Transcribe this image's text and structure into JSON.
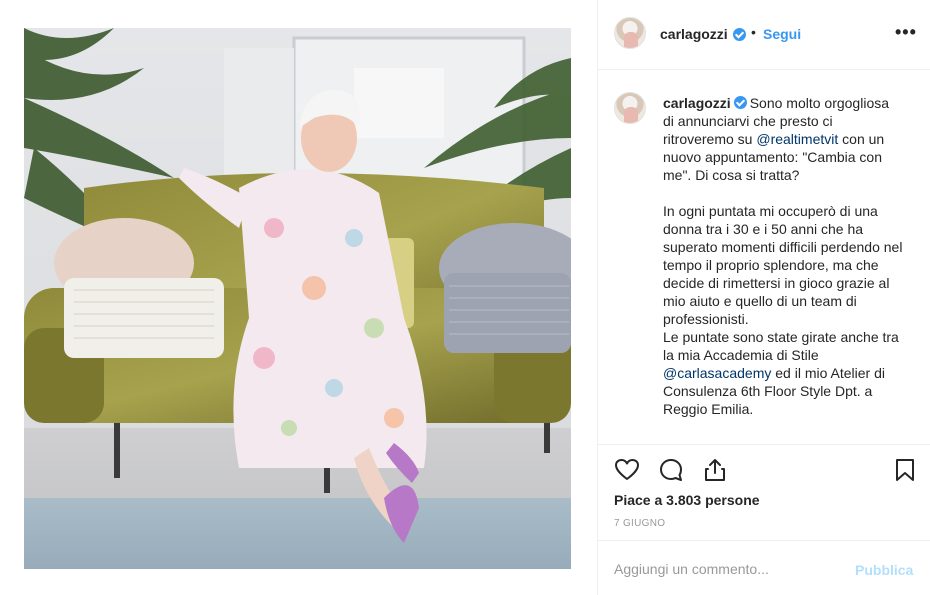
{
  "post": {
    "username": "carlagozzi",
    "separator": "•",
    "follow_label": "Segui",
    "more_label": "•••",
    "caption": {
      "username": "carlagozzi",
      "part1": "Sono molto orgogliosa di annunciarvi che presto ci ritroveremo su ",
      "mention1": "@realtimetvit",
      "part2": " con un nuovo appuntamento: \"Cambia con me\". Di cosa si tratta?\n\nIn ogni puntata mi occuperò di una donna tra i 30 e i 50 anni che ha superato momenti difficili perdendo nel tempo il proprio splendore, ma che decide di rimettersi in gioco grazie al mio aiuto e quello di un team di professionisti.\nLe puntate sono state girate anche tra la mia Accademia di Stile ",
      "mention2": "@carlasacademy",
      "part3": " ed il mio Atelier di Consulenza 6th Floor Style Dpt. a Reggio Emilia."
    },
    "likes_text": "Piace a 3.803 persone",
    "date": "7 GIUGNO",
    "comment_placeholder": "Aggiungi un commento...",
    "publish_label": "Pubblica"
  },
  "icons": {
    "like": "heart-icon",
    "comment": "comment-icon",
    "share": "share-icon",
    "save": "bookmark-icon",
    "verified": "verified-badge-icon"
  },
  "colors": {
    "link_blue": "#3897f0",
    "mention": "#003569",
    "publish_disabled": "#b2dffc",
    "muted": "#999999",
    "text": "#262626"
  }
}
